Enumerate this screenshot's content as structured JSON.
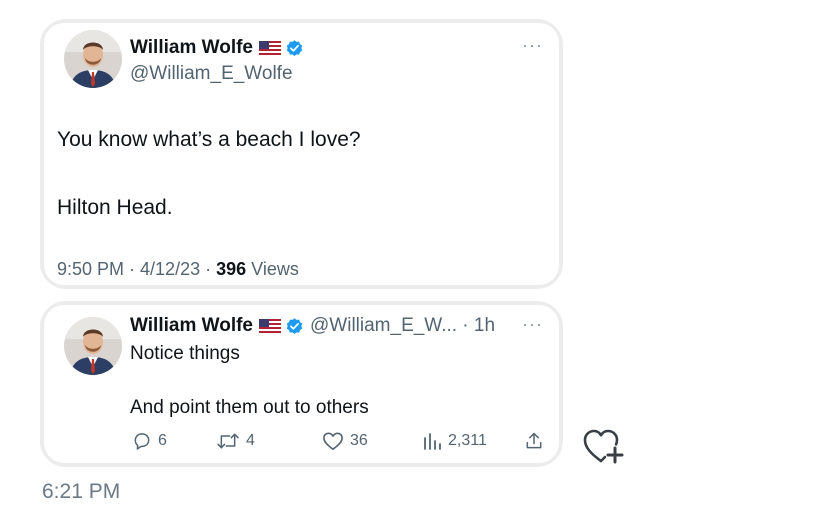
{
  "tweet": {
    "author_name": "William Wolfe",
    "author_handle": "@William_E_Wolfe",
    "text_line_1": "You know what’s a beach I love?",
    "text_line_2": "Hilton Head.",
    "meta_time_date": "9:50 PM · 4/12/23 · ",
    "meta_views_count": "396",
    "meta_views_label": " Views",
    "more_label": "···"
  },
  "reply": {
    "author_name": "William Wolfe",
    "author_handle_time": "@William_E_W... · 1h",
    "text_line_1": "Notice things",
    "text_line_2": "And point them out to others",
    "more_label": "···",
    "actions": {
      "replies": "6",
      "retweets": "4",
      "likes": "36",
      "views": "2,311"
    }
  },
  "message": {
    "time": "6:21 PM"
  },
  "icons": {
    "flag": "us-flag-icon",
    "verified": "verified-badge-icon",
    "reply": "reply-icon",
    "retweet": "retweet-icon",
    "like": "heart-icon",
    "views": "views-icon",
    "share": "share-icon",
    "react": "heart-add-icon"
  },
  "colors": {
    "verified": "#1d9bf0",
    "text_primary": "#0f1419",
    "text_secondary": "#536471",
    "bubble": "#ececec"
  }
}
